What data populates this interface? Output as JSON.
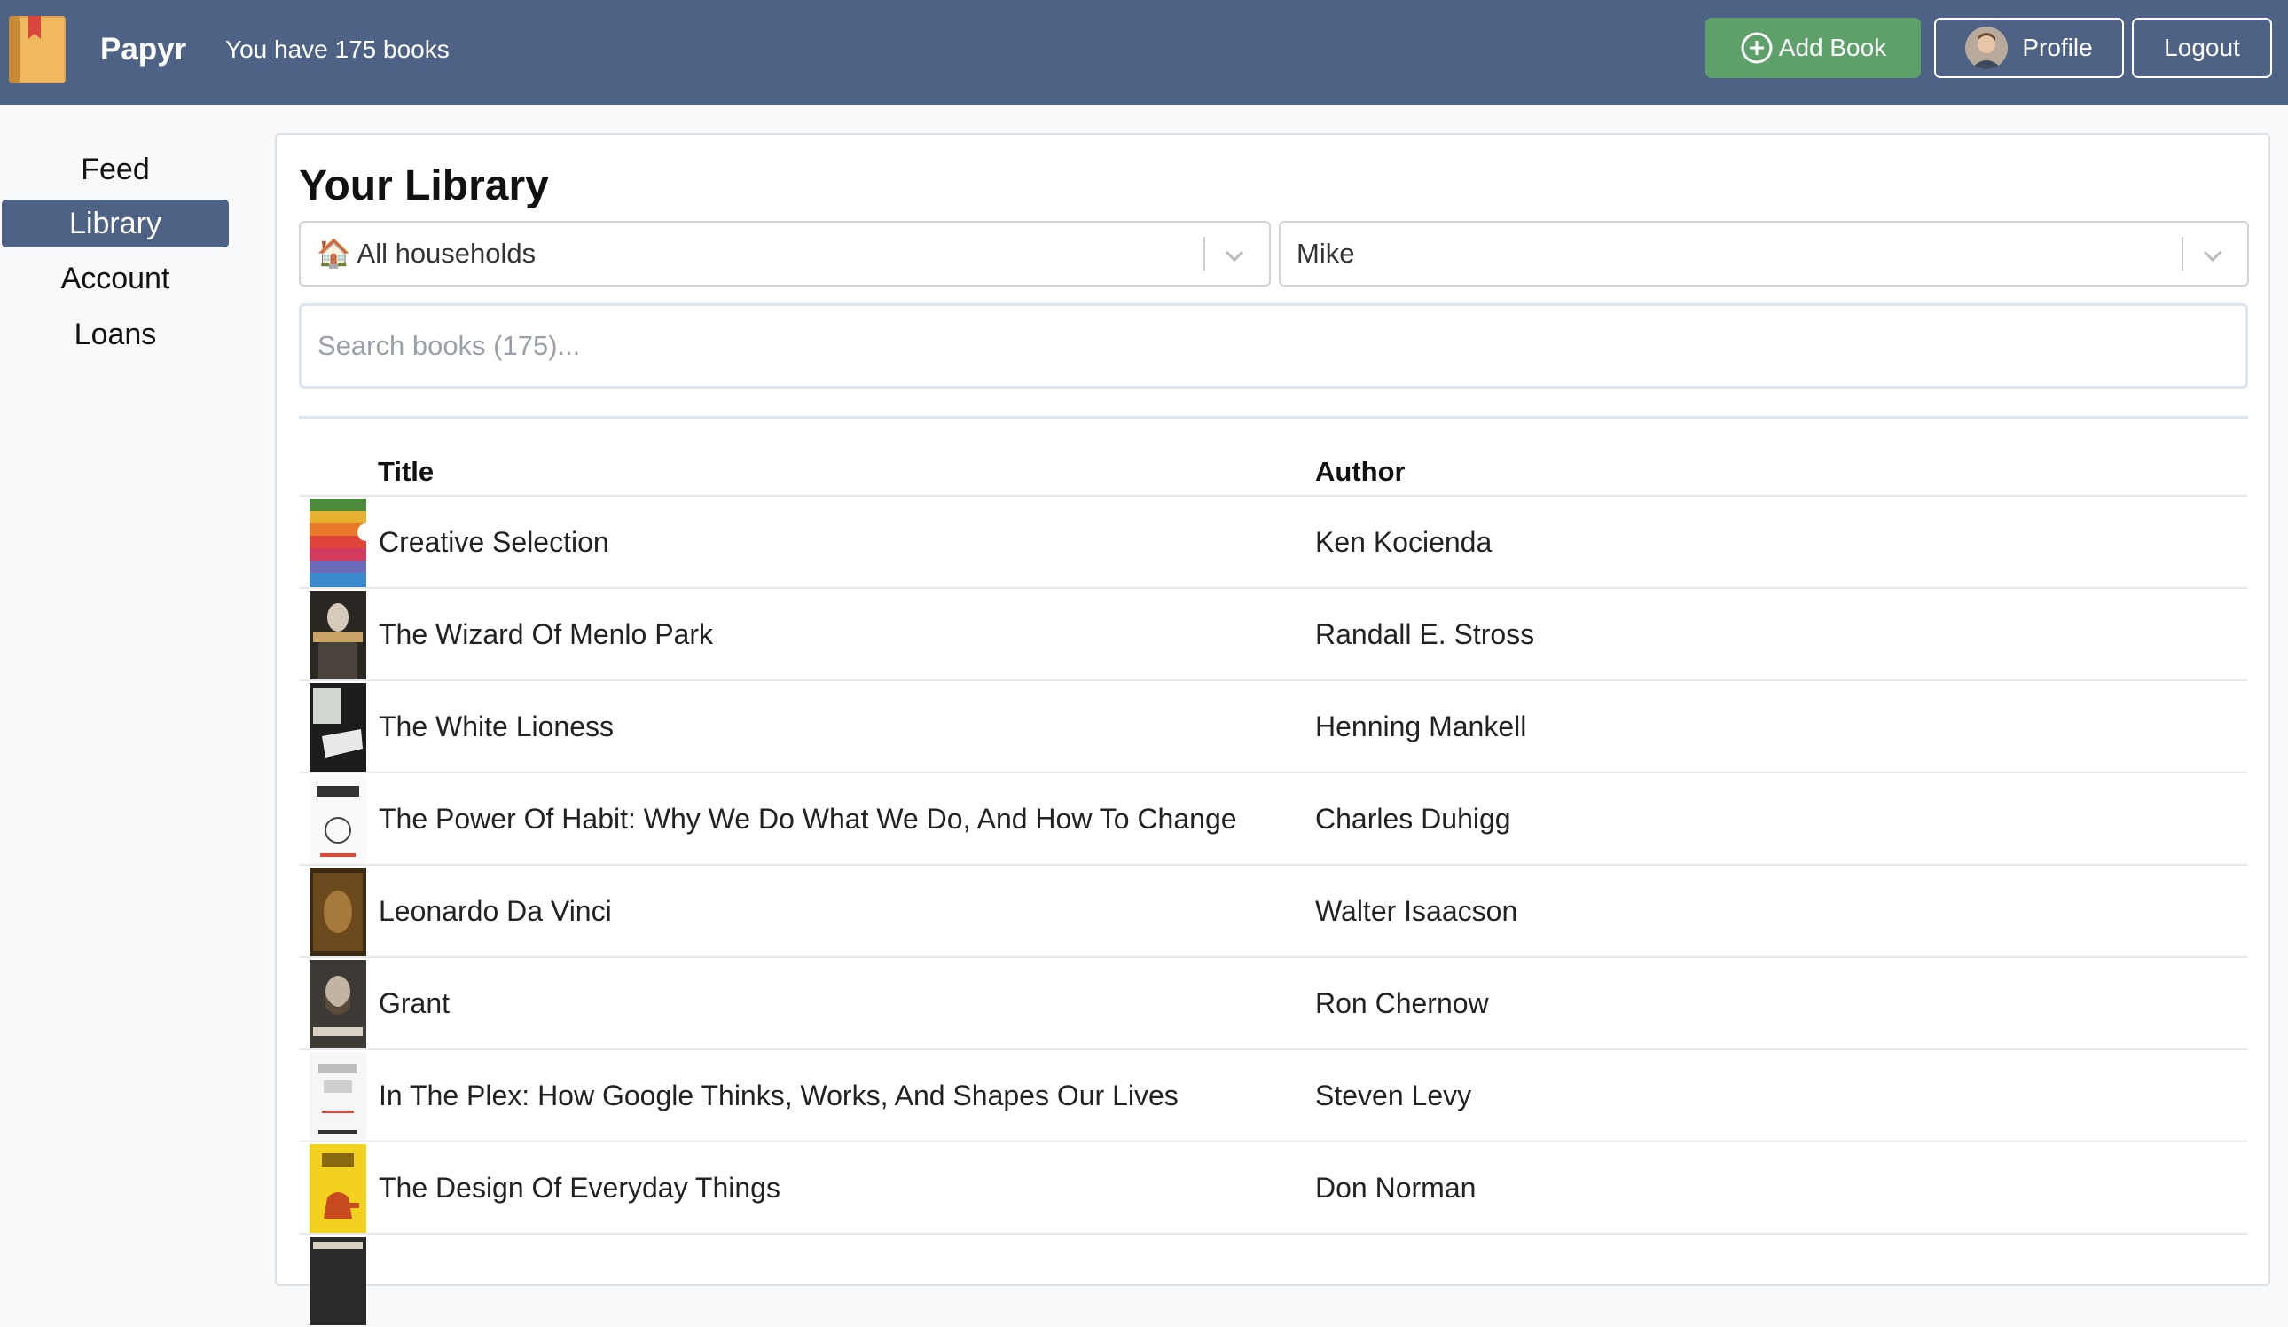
{
  "header": {
    "brand": "Papyr",
    "book_count_text": "You have 175 books",
    "add_book_label": "Add Book",
    "profile_label": "Profile",
    "logout_label": "Logout"
  },
  "sidebar": {
    "items": [
      {
        "label": "Feed",
        "active": false
      },
      {
        "label": "Library",
        "active": true
      },
      {
        "label": "Account",
        "active": false
      },
      {
        "label": "Loans",
        "active": false
      }
    ]
  },
  "library": {
    "heading": "Your Library",
    "household_select": {
      "icon": "🏠",
      "value": "All households"
    },
    "member_select": {
      "value": "Mike"
    },
    "search": {
      "placeholder": "Search books (175)..."
    },
    "columns": {
      "title": "Title",
      "author": "Author"
    },
    "books": [
      {
        "title": "Creative Selection",
        "author": "Ken Kocienda"
      },
      {
        "title": "The Wizard Of Menlo Park",
        "author": "Randall E. Stross"
      },
      {
        "title": "The White Lioness",
        "author": "Henning Mankell"
      },
      {
        "title": "The Power Of Habit: Why We Do What We Do, And How To Change",
        "author": "Charles Duhigg"
      },
      {
        "title": "Leonardo Da Vinci",
        "author": "Walter Isaacson"
      },
      {
        "title": "Grant",
        "author": "Ron Chernow"
      },
      {
        "title": "In The Plex: How Google Thinks, Works, And Shapes Our Lives",
        "author": "Steven Levy"
      },
      {
        "title": "The Design Of Everyday Things",
        "author": "Don Norman"
      }
    ]
  },
  "colors": {
    "navbar": "#4d6284",
    "add_button": "#5da06a",
    "active_nav": "#4d6284"
  }
}
